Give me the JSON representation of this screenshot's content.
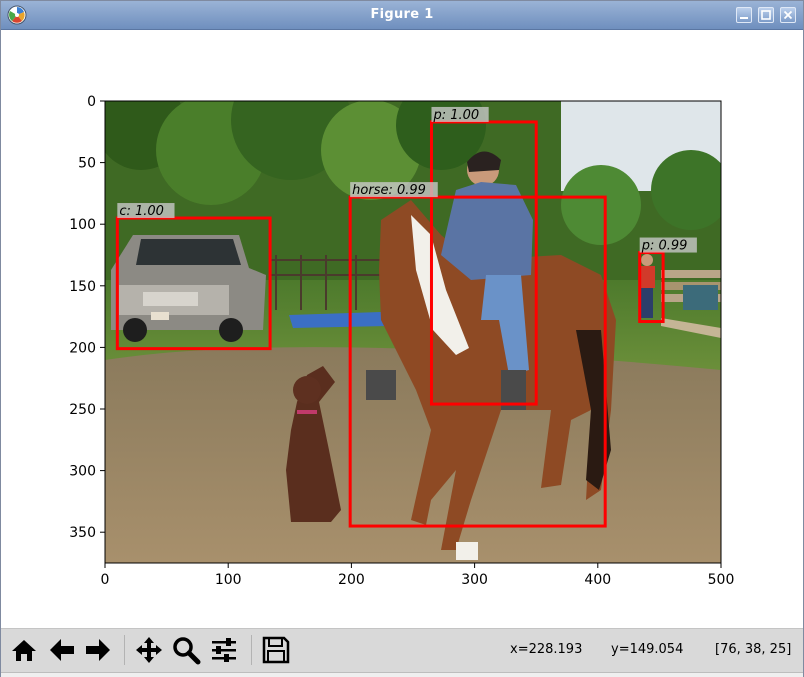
{
  "window": {
    "title": "Figure 1",
    "app_icon": "matplotlib-logo-icon",
    "controls": [
      "minimize-icon",
      "maximize-icon",
      "close-icon"
    ]
  },
  "figure": {
    "photo_description_icon": "photo-horse-rider-dog-truck",
    "x_ticks": [
      0,
      100,
      200,
      300,
      400,
      500
    ],
    "y_ticks": [
      0,
      50,
      100,
      150,
      200,
      250,
      300,
      350
    ],
    "xlim": [
      0,
      500
    ],
    "ylim": [
      375,
      0
    ],
    "box_color": "#ff0000",
    "detections": [
      {
        "label": "p: 1.00",
        "x1": 265,
        "y1": 17,
        "x2": 350,
        "y2": 246
      },
      {
        "label": "horse: 0.99",
        "x1": 199,
        "y1": 78,
        "x2": 406,
        "y2": 345
      },
      {
        "label": "c: 1.00",
        "x1": 10,
        "y1": 95,
        "x2": 134,
        "y2": 201
      },
      {
        "label": "p: 0.99",
        "x1": 434,
        "y1": 123,
        "x2": 453,
        "y2": 179
      }
    ]
  },
  "toolbar": {
    "buttons": [
      {
        "name": "home-button",
        "icon": "home-icon"
      },
      {
        "name": "back-button",
        "icon": "arrow-left-icon"
      },
      {
        "name": "forward-button",
        "icon": "arrow-right-icon"
      },
      {
        "name": "pan-button",
        "icon": "move-arrows-icon"
      },
      {
        "name": "zoom-button",
        "icon": "magnifier-icon"
      },
      {
        "name": "configure-subplots-button",
        "icon": "sliders-icon"
      },
      {
        "name": "save-button",
        "icon": "floppy-disk-icon"
      }
    ],
    "status": {
      "x": "x=228.193",
      "y": "y=149.054",
      "rgb": "[76, 38, 25]"
    }
  }
}
